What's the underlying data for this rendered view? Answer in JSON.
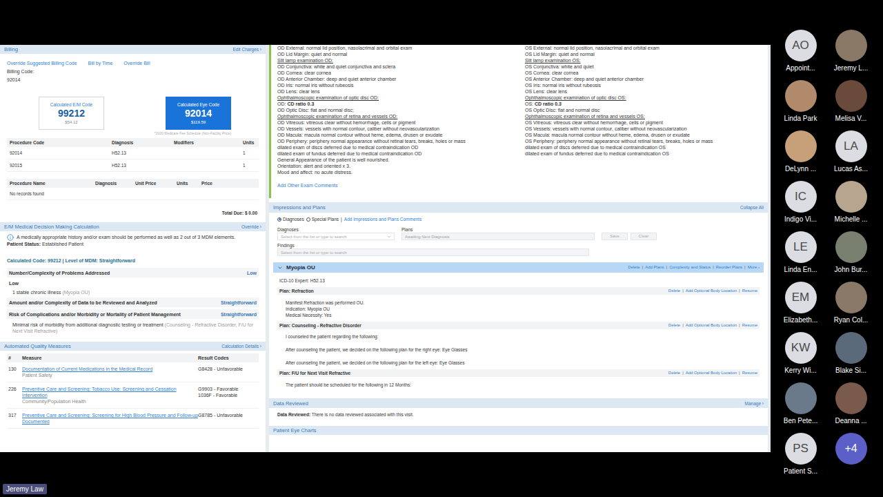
{
  "meeting": {
    "speaker_label": "Jeremy Law"
  },
  "participants": [
    {
      "kind": "initials",
      "initials": "AO",
      "name": "Appoint..."
    },
    {
      "kind": "photo",
      "name": "Jeremy L...",
      "color": "#8a7866"
    },
    {
      "kind": "photo",
      "name": "Linda Park",
      "color": "#b08a6a"
    },
    {
      "kind": "photo",
      "name": "Melisa V...",
      "color": "#6a4a3a"
    },
    {
      "kind": "photo",
      "name": "DeLynn ...",
      "color": "#c7a07a"
    },
    {
      "kind": "initials",
      "initials": "LA",
      "name": "Lucas As..."
    },
    {
      "kind": "initials",
      "initials": "IC",
      "name": "Indigo Vi..."
    },
    {
      "kind": "photo",
      "name": "Michelle ...",
      "color": "#b8a590"
    },
    {
      "kind": "initials",
      "initials": "LE",
      "name": "Linda En..."
    },
    {
      "kind": "photo",
      "name": "John Bur...",
      "color": "#7a8070"
    },
    {
      "kind": "initials",
      "initials": "EM",
      "name": "Elizabeth..."
    },
    {
      "kind": "photo",
      "name": "Ryan Col...",
      "color": "#8a7868"
    },
    {
      "kind": "initials",
      "initials": "KW",
      "name": "Kerry Wi..."
    },
    {
      "kind": "photo",
      "name": "Blake Si...",
      "color": "#5a6a7a"
    },
    {
      "kind": "photo",
      "name": "Ben Pete...",
      "color": "#6a7a8a"
    },
    {
      "kind": "photo",
      "name": "Deanna ...",
      "color": "#7a5a4a"
    },
    {
      "kind": "initials",
      "initials": "PS",
      "name": "Patient S..."
    },
    {
      "kind": "more",
      "initials": "+4",
      "name": ""
    }
  ],
  "billing": {
    "title": "Billing",
    "edit": "Edit Charges ›",
    "links": [
      "Override Suggested Billing Code",
      "Bill by Time",
      "Override Bill"
    ],
    "code_label": "Billing Code:",
    "code": "92014",
    "cards": [
      {
        "label": "Calculated E/M Code",
        "code": "99212",
        "price": "$54.12",
        "selected": false
      },
      {
        "label": "Calculated Eye Code",
        "code": "92014",
        "price": "$119.59",
        "selected": true
      }
    ],
    "fee_note": "*2020 Medicare Fee Schedule (Non-Facility Price)",
    "procedures": {
      "columns": [
        "Procedure Code",
        "Diagnosis",
        "Modifiers",
        "Units"
      ],
      "rows": [
        [
          "92014",
          "H52.13",
          "",
          "1"
        ],
        [
          "92015",
          "H52.13",
          "",
          "1"
        ]
      ]
    },
    "charges": {
      "columns": [
        "Procedure Name",
        "Diagnosis",
        "Unit Price",
        "Units",
        "Price"
      ],
      "empty": "No records found"
    },
    "total": "Total Due: $ 0.00"
  },
  "mdm": {
    "title": "E/M Medical Decision Making Calculation",
    "override": "Override ›",
    "note": "A medically appropriate history and/or exam should be performed as well as 2 out of 3 MDM elements.",
    "status_label": "Patient Status:",
    "status": "Established Patient",
    "calculated": "Calculated Code: 99212 | Level of MDM: Straightforward",
    "criteria": [
      {
        "title": "Number/Complexity of Problems Addressed",
        "level": "Low",
        "sub_level": "Low",
        "detail": "1 stable chronic illness",
        "detail_note": "(Myopia OU)"
      },
      {
        "title": "Amount and/or Complexity of Data to be Reviewed and Analyzed",
        "level": "Straightforward"
      },
      {
        "title": "Risk of Complications and/or Morbidity or Mortality of Patient Management",
        "level": "Straightforward",
        "detail": "Minimal risk of morbidity from additional diagnostic testing or treatment",
        "detail_note": "(Counseling - Refractive Disorder, F/U for Next Visit Refractive)"
      }
    ]
  },
  "quality": {
    "title": "Automated Quality Measures",
    "details": "Calculation Details ›",
    "columns": [
      "#",
      "Measure",
      "Result Codes"
    ],
    "rows": [
      {
        "id": "130",
        "measure": "Documentation of Current Medications in the Medical Record",
        "category": "Patient Safety",
        "results": [
          "G8428 - Unfavorable"
        ]
      },
      {
        "id": "226",
        "measure": "Preventive Care and Screening: Tobacco Use: Screening and Cessation Intervention",
        "category": "Community/Population Health",
        "results": [
          "G9903 - Favorable",
          "1036F - Favorable"
        ]
      },
      {
        "id": "317",
        "measure": "Preventive Care and Screening: Screening for High Blood Pressure and Follow-up Documented",
        "category": "",
        "results": [
          "G8785 - Unfavorable"
        ]
      }
    ]
  },
  "exam": {
    "od": [
      {
        "kind": "line",
        "text": "OD External: normal lid position, nasolacrimal and orbital exam"
      },
      {
        "kind": "line",
        "text": "OD Lid Margin: quiet and normal"
      },
      {
        "kind": "heading",
        "text": "Slit lamp examination OD:"
      },
      {
        "kind": "line",
        "text": "OD Conjunctiva: white and quiet conjunctiva and sclera"
      },
      {
        "kind": "line",
        "text": "OD Cornea: clear cornea"
      },
      {
        "kind": "line",
        "text": "OD Anterior Chamber: deep and quiet anterior chamber"
      },
      {
        "kind": "line",
        "text": "OD Iris: normal iris without rubeosis"
      },
      {
        "kind": "line",
        "text": "OD Lens: clear lens"
      },
      {
        "kind": "heading",
        "text": "Ophthalmoscopic examination of optic disc OD:"
      },
      {
        "kind": "ratio",
        "label": "OD:",
        "value": "CD ratio 0.3"
      },
      {
        "kind": "line",
        "text": "OD Optic Disc: flat and normal disc;"
      },
      {
        "kind": "heading",
        "text": "Ophthalmoscopic examination of retina and vessels OD:"
      },
      {
        "kind": "line",
        "text": "OD Vitreous: vitreous clear without hemorrhage, cells or pigment"
      },
      {
        "kind": "line",
        "text": "OD Vessels: vessels with normal contour, caliber without neovascularization"
      },
      {
        "kind": "line",
        "text": "OD Macula: macula normal contour without heme, edema, drusen or exudate"
      },
      {
        "kind": "line",
        "text": "OD Periphery: periphery normal appearance without retinal tears, breaks, holes or mass"
      },
      {
        "kind": "line",
        "text": "dilated exam of discs deferred due to medical contraindication OD"
      },
      {
        "kind": "line",
        "text": "dilated exam of fundus deferred due to medical contraindication OD"
      },
      {
        "kind": "line",
        "text": "General Appearance of the patient is well nourished."
      },
      {
        "kind": "line",
        "text": "Orientation: alert and oriented x 3."
      },
      {
        "kind": "line",
        "text": "Mood and affect: no acute distress."
      }
    ],
    "os": [
      {
        "kind": "line",
        "text": "OS External: normal lid position, nasolacrimal and orbital exam"
      },
      {
        "kind": "line",
        "text": "OS Lid Margin: quiet and normal"
      },
      {
        "kind": "heading",
        "text": "Slit lamp examination OS:"
      },
      {
        "kind": "line",
        "text": "OS Conjunctiva: white and quiet"
      },
      {
        "kind": "line",
        "text": "OS Cornea: clear cornea"
      },
      {
        "kind": "line",
        "text": "OS Anterior Chamber: deep and quiet anterior chamber"
      },
      {
        "kind": "line",
        "text": "OS Iris: normal iris without rubeosis"
      },
      {
        "kind": "line",
        "text": "OS Lens: clear lens"
      },
      {
        "kind": "heading",
        "text": "Ophthalmoscopic examination of optic disc OS:"
      },
      {
        "kind": "ratio",
        "label": "OS:",
        "value": "CD ratio 0.3"
      },
      {
        "kind": "line",
        "text": "OS Optic Disc: flat and normal disc"
      },
      {
        "kind": "heading",
        "text": "Ophthalmoscopic examination of retina and vessels OS:"
      },
      {
        "kind": "line",
        "text": "OS Vitreous: vitreous clear without hemorrhage, cells or pigment"
      },
      {
        "kind": "line",
        "text": "OS Vessels: vessels with normal contour, caliber without neovascularization"
      },
      {
        "kind": "line",
        "text": "OS Macula: macula normal contour without heme, edema, drusen or exudate"
      },
      {
        "kind": "line",
        "text": "OS Periphery: periphery normal appearance without retinal tears, breaks, holes or mass"
      },
      {
        "kind": "line",
        "text": "dilated exam of discs deferred due to medical contraindication OS"
      },
      {
        "kind": "line",
        "text": "dilated exam of fundus deferred due to medical contraindication OS"
      }
    ],
    "add_link": "Add Other Exam Comments"
  },
  "impressions": {
    "title": "Impressions and Plans",
    "collapse": "Collapse All",
    "modes": [
      {
        "label": "Diagnoses",
        "selected": true
      },
      {
        "label": "Special Plans",
        "selected": false
      }
    ],
    "separator": "|",
    "comments_link": "Add Impressions and Plans Comments",
    "diagnoses_label": "Diagnoses",
    "diagnoses_placeholder": "Select from the list or type to search",
    "plans_label": "Plans",
    "plans_placeholder": "Awaiting Next Diagnosis",
    "buttons": [
      "Save",
      "Clear"
    ],
    "findings_label": "Findings",
    "findings_placeholder": "Select from the list or type to search",
    "diagnosis": {
      "name": "Myopia OU",
      "expanded": true,
      "actions": [
        "Delete",
        "Add Plans",
        "Complexity and Status",
        "Reorder Plans",
        "More ›"
      ],
      "icd": "ICD-10 Expert: H52.13",
      "plans": [
        {
          "title": "Plan: Refraction",
          "spaced": false,
          "actions": [
            "Delete",
            "Add Optional Body Location",
            "Resume"
          ],
          "lines": [
            "Manifest Refraction was performed OU.",
            "Indication: Myopia OU",
            "Medical Necessity: Yes"
          ]
        },
        {
          "title": "Plan: Counseling - Refractive Disorder",
          "spaced": true,
          "actions": [
            "Delete",
            "Add Optional Body Location",
            "Resume"
          ],
          "lines": [
            "I counseled the patient regarding the following:",
            "After counseling the patient, we decided on the following plan for the right eye: Eye Glasses",
            "After counseling the patient, we decided on the following plan for the left eye: Eye Glasses"
          ]
        },
        {
          "title": "Plan: F/U for Next Visit Refractive",
          "spaced": false,
          "actions": [
            "Delete",
            "Add Optional Body Location",
            "Resume"
          ],
          "lines": [
            "The patient should be scheduled for the following in 12 Months:"
          ]
        }
      ]
    }
  },
  "data_reviewed": {
    "title": "Data Reviewed",
    "manage": "Manage ›",
    "label": "Data Reviewed:",
    "text": "There is no data reviewed associated with this visit."
  },
  "eye_charts": {
    "title": "Patient Eye Charts"
  }
}
